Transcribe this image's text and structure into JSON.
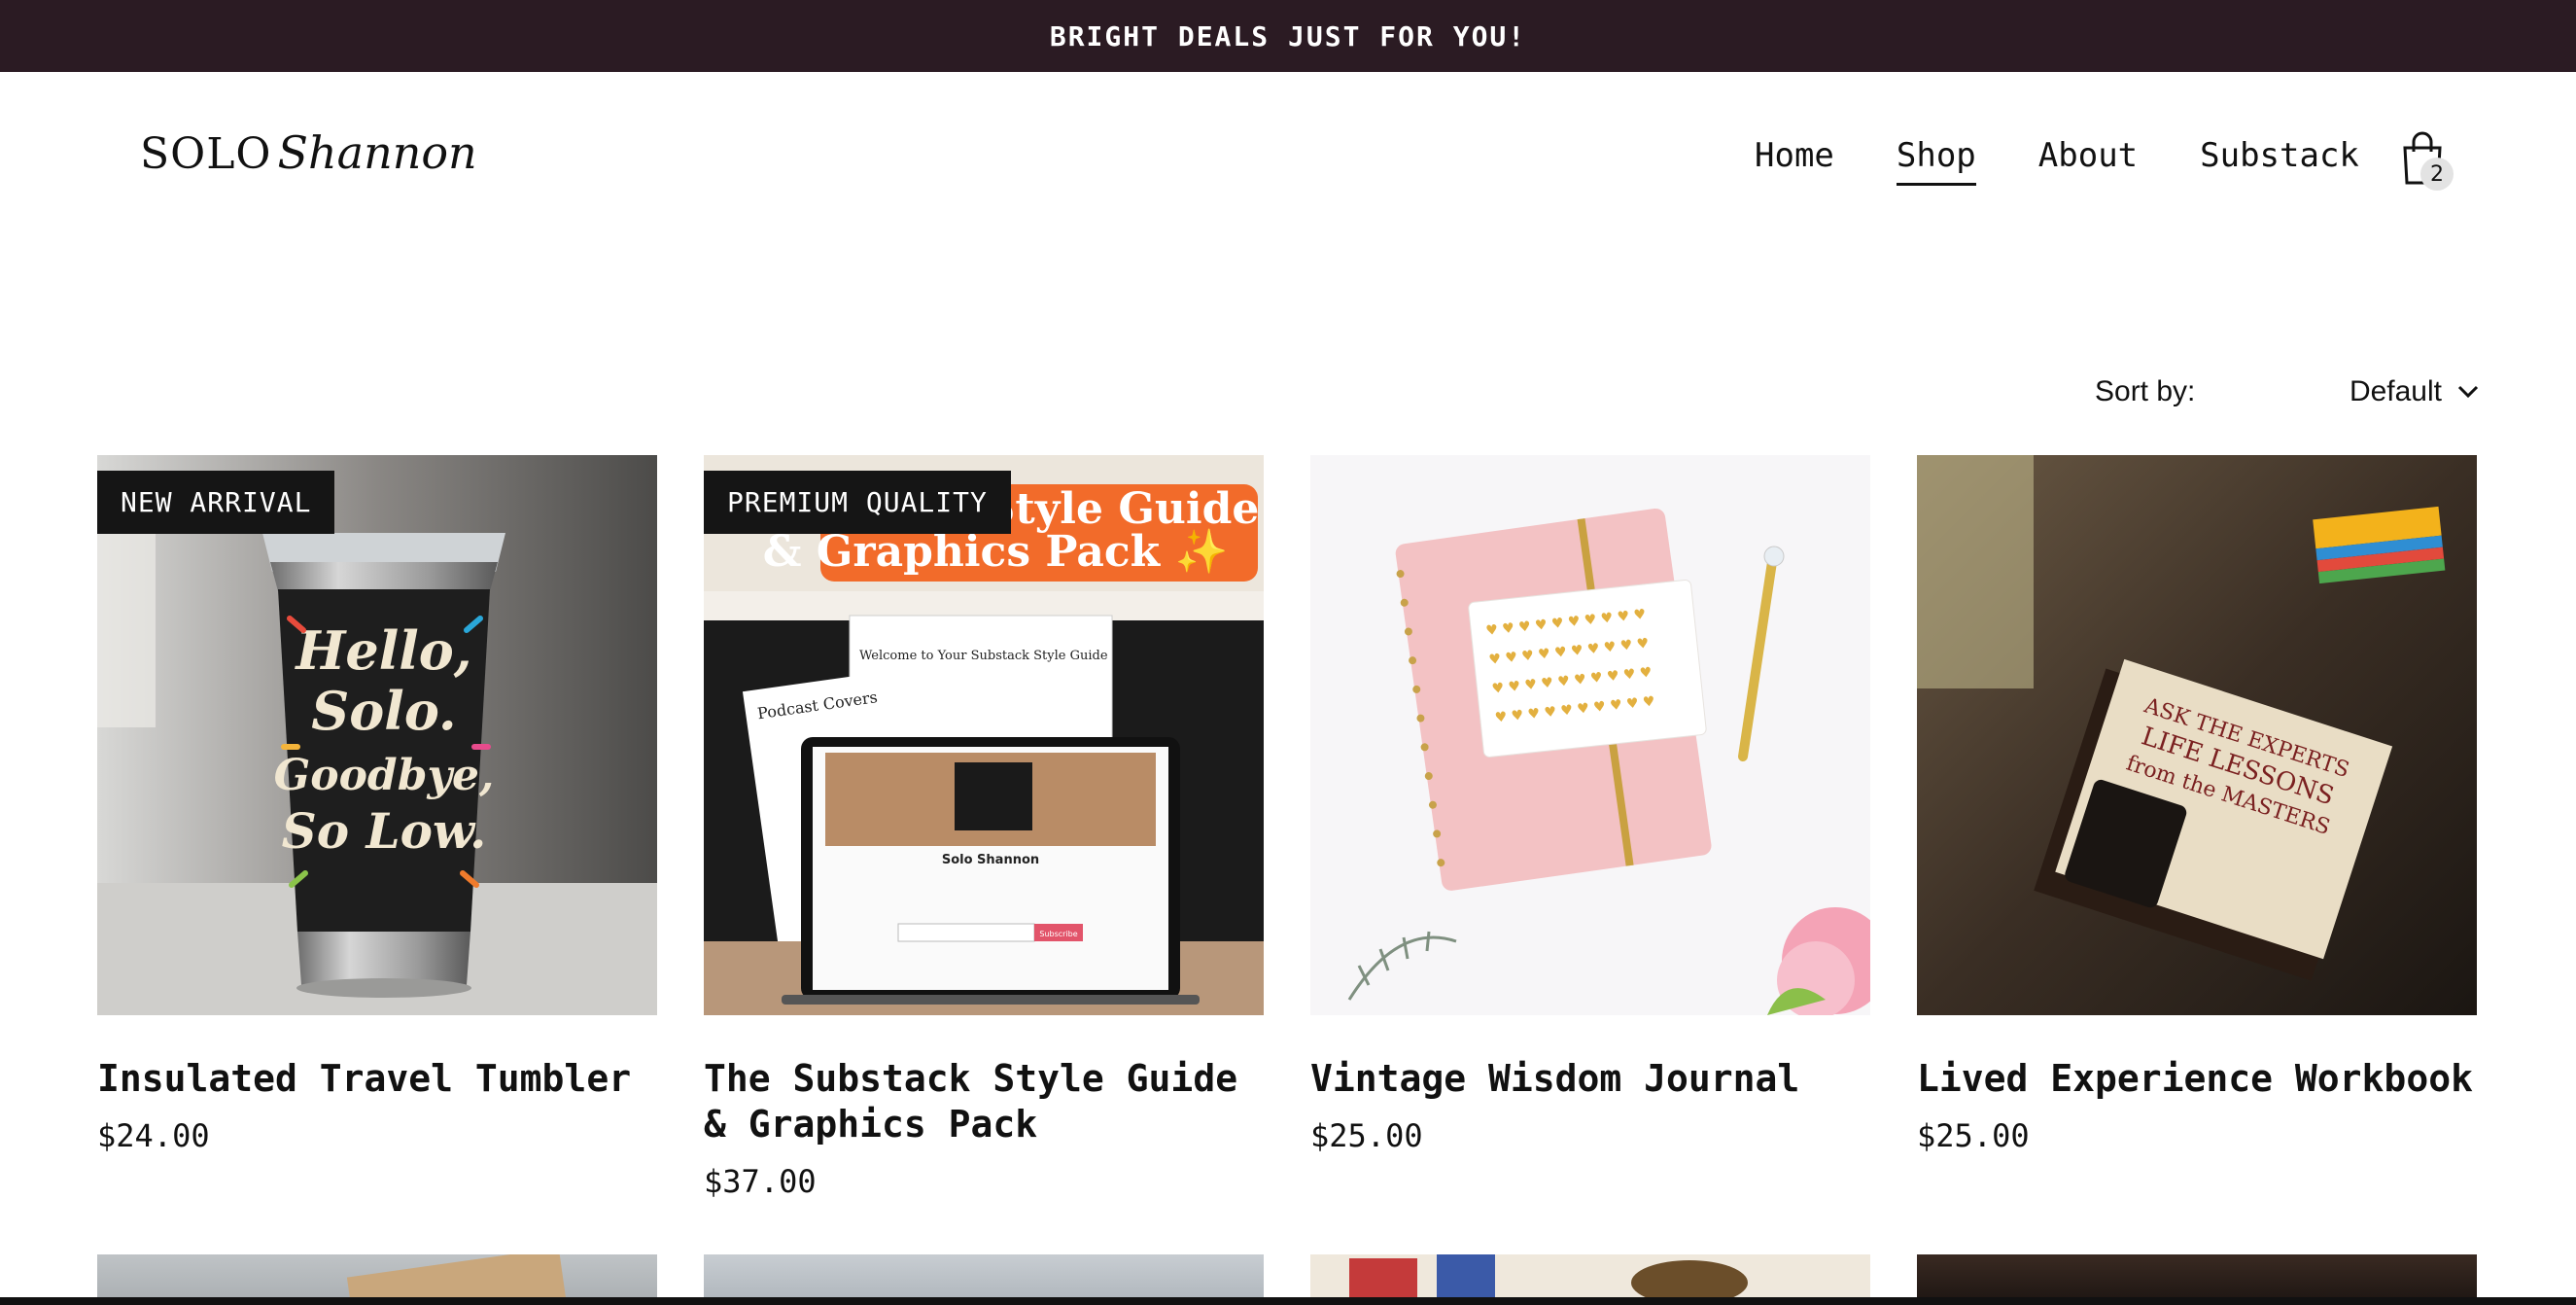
{
  "announcement": "BRIGHT DEALS JUST FOR YOU!",
  "logo": {
    "solo": "SOLO",
    "script": "Shannon"
  },
  "nav": {
    "items": [
      "Home",
      "Shop",
      "About",
      "Substack"
    ],
    "active": "Shop"
  },
  "cart": {
    "count": "2"
  },
  "sort": {
    "label": "Sort by:",
    "value": "Default"
  },
  "products": [
    {
      "badge": "NEW ARRIVAL",
      "title": "Insulated Travel Tumbler",
      "price": "$24.00"
    },
    {
      "badge": "PREMIUM QUALITY",
      "title": "The Substack Style Guide & Graphics Pack",
      "price": "$37.00"
    },
    {
      "badge": "",
      "title": "Vintage Wisdom Journal",
      "price": "$25.00"
    },
    {
      "badge": "",
      "title": "Lived Experience Workbook",
      "price": "$25.00"
    }
  ],
  "image_text": {
    "tumbler": [
      "Hello,",
      "Solo.",
      "Goodbye,",
      "So Low."
    ],
    "guide_banner": [
      "Style Guide",
      "& Graphics Pack ✨"
    ],
    "guide_screen": [
      "Welcome to Your Substack Style Guide",
      "Podcast Covers",
      "Solo Shannon",
      "Subscribe"
    ],
    "book": [
      "ASK THE EXPERTS",
      "LIFE LESSONS",
      "from the MASTERS"
    ]
  },
  "colors": {
    "announce_bg": "#2b1b23",
    "accent_heart": "#d33333",
    "subscribe": "#e2546a"
  }
}
